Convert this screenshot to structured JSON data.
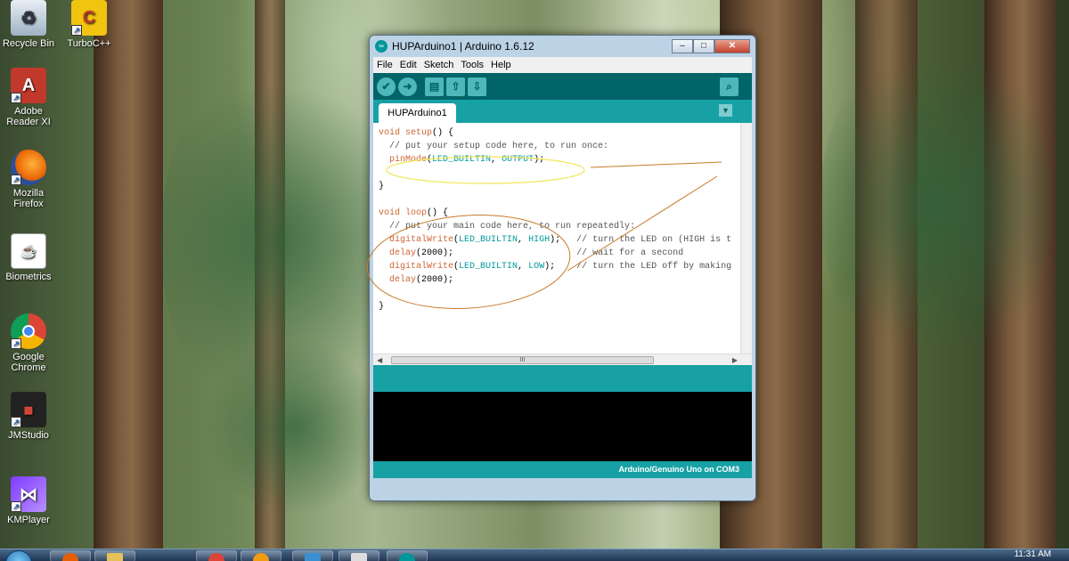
{
  "desktop": {
    "icons": [
      {
        "label": "Recycle Bin"
      },
      {
        "label": "TurboC++"
      },
      {
        "label": "Adobe Reader XI"
      },
      {
        "label": "Mozilla Firefox"
      },
      {
        "label": "Biometrics"
      },
      {
        "label": "Google Chrome"
      },
      {
        "label": "JMStudio"
      },
      {
        "label": "KMPlayer"
      }
    ]
  },
  "window": {
    "title": "HUPArduino1 | Arduino 1.6.12",
    "buttons": {
      "minimize": "–",
      "maximize": "□",
      "close": "✕"
    },
    "menu": [
      "File",
      "Edit",
      "Sketch",
      "Tools",
      "Help"
    ],
    "tab": "HUPArduino1",
    "code": {
      "l1_kw": "void",
      "l1_fn": " setup",
      "l1_rest": "() {",
      "l2": "  // put your setup code here, to run once:",
      "l3_fn": "  pinMode",
      "l3_open": "(",
      "l3_a": "LED_BUILTIN",
      "l3_sep": ", ",
      "l3_b": "OUTPUT",
      "l3_close": ");",
      "l5": "}",
      "l7_kw": "void",
      "l7_fn": " loop",
      "l7_rest": "() {",
      "l8": "  // put your main code here, to run repeatedly:",
      "l9_fn": "  digitalWrite",
      "l9_open": "(",
      "l9_a": "LED_BUILTIN",
      "l9_sep": ", ",
      "l9_b": "HIGH",
      "l9_close": ");   ",
      "l9_cm": "// turn the LED on (HIGH is t",
      "l10_fn": "  delay",
      "l10_args": "(2000);",
      "l10_pad": "                       ",
      "l10_cm": "// wait for a second",
      "l11_fn": "  digitalWrite",
      "l11_open": "(",
      "l11_a": "LED_BUILTIN",
      "l11_sep": ", ",
      "l11_b": "LOW",
      "l11_close": ");    ",
      "l11_cm": "// turn the LED off by making",
      "l12_fn": "  delay",
      "l12_args": "(2000);",
      "l14": "}"
    },
    "scroll_grip": "III",
    "status": "Arduino/Genuino Uno on COM3"
  },
  "taskbar": {
    "clock": "11:31 AM"
  },
  "colors": {
    "toolbar": "#006468",
    "tabrow": "#17a1a5",
    "annotation": "#c87a2a",
    "annotation_highlight": "#f2e65a"
  }
}
